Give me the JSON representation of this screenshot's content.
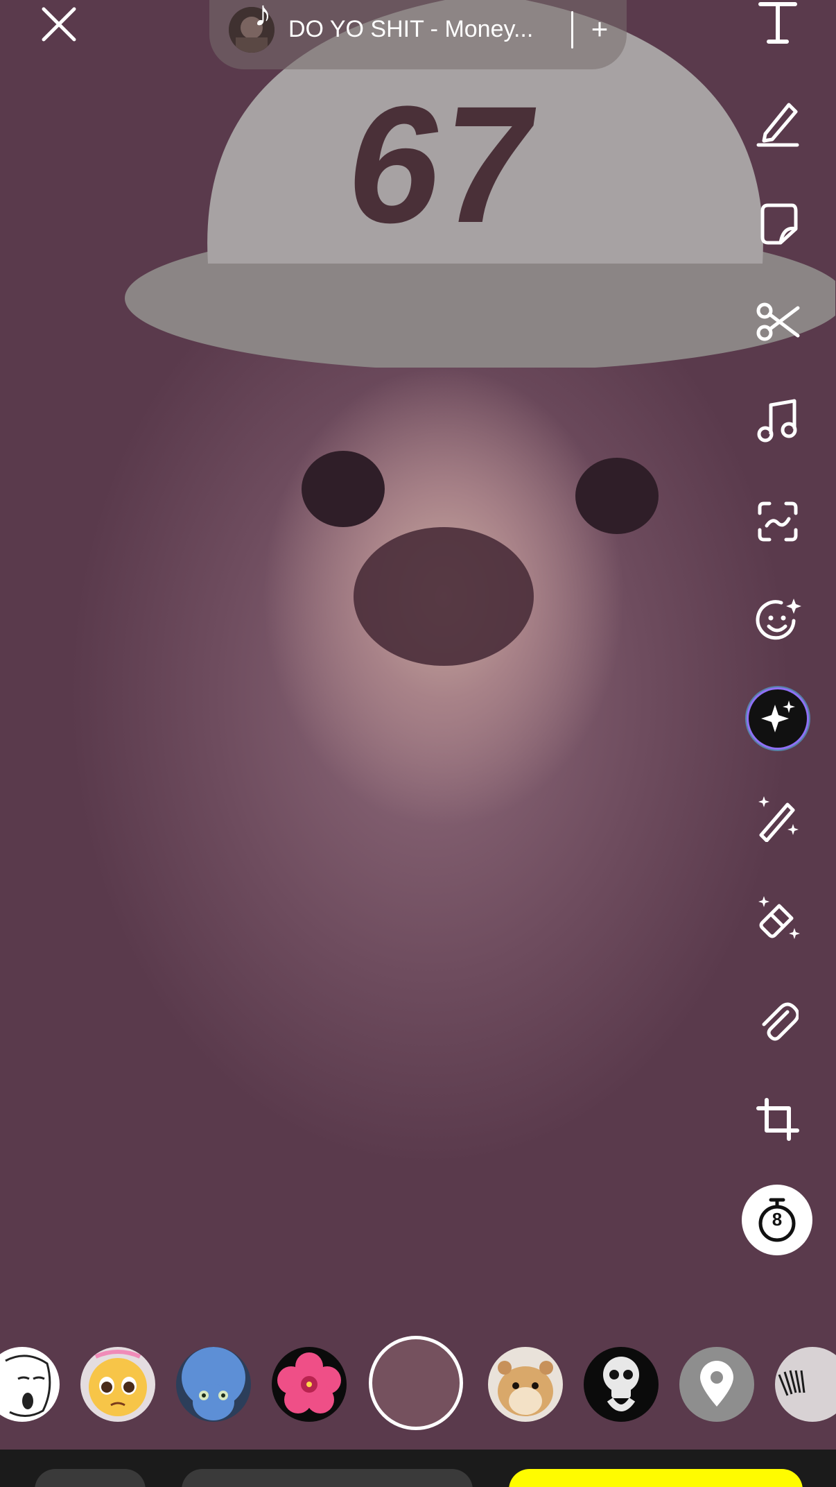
{
  "music": {
    "title": "DO YO SHIT - Money...",
    "add_label": "+"
  },
  "toolbar": {
    "items": [
      "text-tool",
      "draw-tool",
      "sticker-tool",
      "scissors-tool",
      "music-tool",
      "scan-tool",
      "emoji-tool",
      "ai-sparkle-tool",
      "magic-wand-tool",
      "magic-eraser-tool",
      "attach-link-tool",
      "crop-tool",
      "timer-tool"
    ]
  },
  "timer": {
    "value": "8"
  },
  "lenses": [
    {
      "name": "lens-wojak"
    },
    {
      "name": "lens-pleading-emoji"
    },
    {
      "name": "lens-megamind"
    },
    {
      "name": "lens-hibiscus"
    },
    {
      "name": "lens-hamster"
    },
    {
      "name": "lens-skull"
    },
    {
      "name": "lens-location"
    },
    {
      "name": "lens-eyelash"
    }
  ],
  "colors": {
    "accent_yellow": "#fffc00",
    "icon_white": "#ffffff"
  }
}
